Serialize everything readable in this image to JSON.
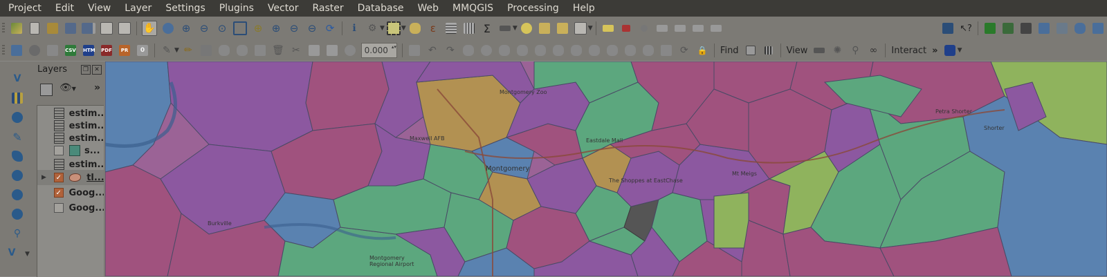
{
  "menubar": {
    "items": [
      {
        "label": "Project",
        "key": "P",
        "rest": "roject"
      },
      {
        "label": "Edit",
        "key": "E",
        "rest": "dit"
      },
      {
        "label": "View",
        "key": "V",
        "rest": "iew"
      },
      {
        "label": "Layer",
        "key": "L",
        "rest": "ayer"
      },
      {
        "label": "Settings",
        "key": "S",
        "rest": "ettings"
      },
      {
        "label": "Plugins",
        "key": "P",
        "rest": "lugins"
      },
      {
        "label": "Vector",
        "key": "V",
        "rest": "ector"
      },
      {
        "label": "Raster",
        "key": "R",
        "rest": "aster"
      },
      {
        "label": "Database",
        "key": "D",
        "rest": "atabase"
      },
      {
        "label": "Web",
        "key": "W",
        "rest": "eb"
      },
      {
        "label": "MMQGIS",
        "key": "M",
        "rest": "MQGIS"
      },
      {
        "label": "Processing",
        "key": "P",
        "rest": "rocessing"
      },
      {
        "label": "Help",
        "key": "H",
        "rest": "elp"
      }
    ]
  },
  "toolbar2": {
    "csv_label": "CSV",
    "htm_label": "HTM",
    "pdf_label": "PDF",
    "pr_label": "PR",
    "zero_label": "0",
    "rotation_value": "0.000",
    "find_label": "Find",
    "view_label": "View",
    "interact_label": "Interact",
    "more_label": "»"
  },
  "layers_panel": {
    "title": "Layers",
    "more_label": "»",
    "items": [
      {
        "label": "estim...",
        "type": "table"
      },
      {
        "label": "estim...",
        "type": "table"
      },
      {
        "label": "estim...",
        "type": "table"
      },
      {
        "label": "s...",
        "type": "polygon",
        "checked": false
      },
      {
        "label": "estim...",
        "type": "table"
      },
      {
        "label": "tl...",
        "type": "polygon",
        "checked": true,
        "selected": true
      },
      {
        "label": "Goog...",
        "type": "raster",
        "checked": true
      },
      {
        "label": "Goog...",
        "type": "raster",
        "checked": false
      }
    ]
  },
  "map": {
    "labels": [
      "Montgomery",
      "Eastdale Mall",
      "The Shoppes at EastChase",
      "Mt Meigs",
      "Petra Shorter",
      "Shorter",
      "Maxwell AFB",
      "Burkville",
      "Montgomery Regional Airport",
      "Montgomery Zoo"
    ]
  },
  "colors": {
    "purple": "#8c58a0",
    "magenta": "#a0527e",
    "green": "#5ca77e",
    "blue": "#5a82b0",
    "orange": "#b29152",
    "lime": "#8fb35d",
    "gray": "#555555"
  }
}
